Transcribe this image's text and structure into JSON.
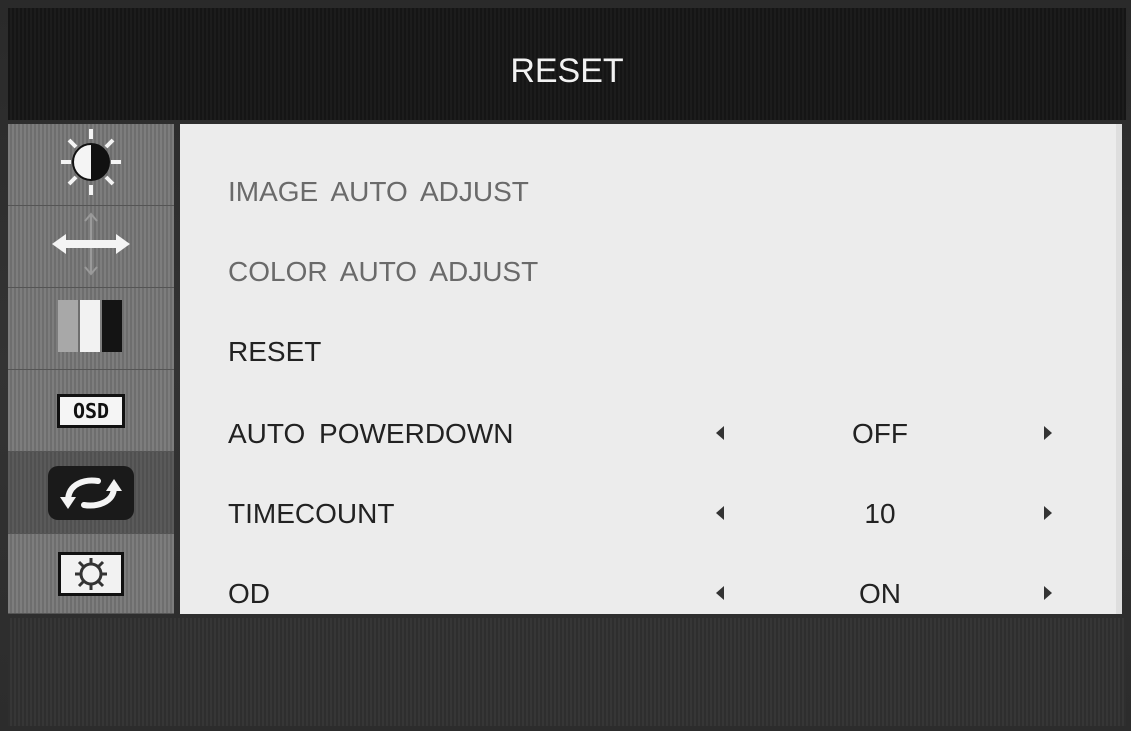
{
  "header": {
    "title": "RESET"
  },
  "sidebar": {
    "items": [
      {
        "icon": "brightness-contrast-icon",
        "active": false
      },
      {
        "icon": "position-arrows-icon",
        "active": false
      },
      {
        "icon": "color-bars-icon",
        "active": false
      },
      {
        "icon": "osd-icon",
        "label": "OSD",
        "active": false
      },
      {
        "icon": "reset-cycle-icon",
        "active": true
      },
      {
        "icon": "gear-icon",
        "active": false
      }
    ]
  },
  "menu": {
    "items": [
      {
        "label": "IMAGE AUTO ADJUST",
        "dim": true
      },
      {
        "label": "COLOR AUTO ADJUST",
        "dim": true
      },
      {
        "label": "RESET",
        "dim": false
      },
      {
        "label": "AUTO POWERDOWN",
        "value": "OFF"
      },
      {
        "label": "TIMECOUNT",
        "value": "10"
      },
      {
        "label": "OD",
        "value": "ON"
      }
    ]
  }
}
